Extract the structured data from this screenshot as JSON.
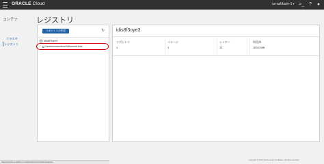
{
  "header": {
    "brand_bold": "ORACLE",
    "brand_light": " Cloud",
    "region": "us-ashburn-1",
    "icons": [
      "menu-icon",
      "cloud-shell-icon",
      "help-icon",
      "user-icon"
    ]
  },
  "sidebar": {
    "title": "コンテナ",
    "items": [
      {
        "label": "クラスタ"
      },
      {
        "label": "レジストリ",
        "active": true
      }
    ]
  },
  "page": {
    "title": "レジストリ"
  },
  "left_panel": {
    "create_label": "リポジトリの作成",
    "root_label": "idis8f3oye3",
    "child_label": "functions/sandbox/helloworld-func"
  },
  "right_panel": {
    "title": "idis8f3oye3",
    "stats": [
      {
        "label": "リポジトリ",
        "value": "1"
      },
      {
        "label": "イメージ",
        "value": "1"
      },
      {
        "label": "レイヤー",
        "value": "12"
      },
      {
        "label": "利用済",
        "value": "163.2 MB"
      }
    ]
  },
  "footer": {
    "copyright": "Copyright © 2019, Oracle and/or its affiliates. All rights reserved.",
    "status_url": "https://console.us-ashburn-1.oraclecloud.com/containers/registry/..."
  },
  "colors": {
    "topbar": "#313131",
    "accent": "#1f60a8",
    "highlight": "#d00000"
  }
}
